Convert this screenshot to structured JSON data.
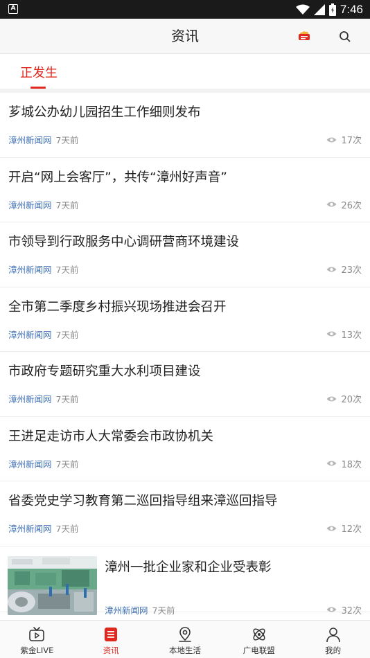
{
  "status_bar": {
    "time": "7:46",
    "left_icon_letter": "A"
  },
  "header": {
    "title": "资讯",
    "weather_icon": "weather-badge-icon",
    "search_icon": "search-icon"
  },
  "tabs": [
    {
      "label": "正发生",
      "active": true
    }
  ],
  "news": [
    {
      "title": "芗城公办幼儿园招生工作细则发布",
      "source": "漳州新闻网",
      "time": "7天前",
      "views": "17次"
    },
    {
      "title": "开启“网上会客厅”，共传“漳州好声音”",
      "source": "漳州新闻网",
      "time": "7天前",
      "views": "26次"
    },
    {
      "title": "市领导到行政服务中心调研营商环境建设",
      "source": "漳州新闻网",
      "time": "7天前",
      "views": "23次"
    },
    {
      "title": "全市第二季度乡村振兴现场推进会召开",
      "source": "漳州新闻网",
      "time": "7天前",
      "views": "13次"
    },
    {
      "title": "市政府专题研究重大水利项目建设",
      "source": "漳州新闻网",
      "time": "7天前",
      "views": "20次"
    },
    {
      "title": "王进足走访市人大常委会市政协机关",
      "source": "漳州新闻网",
      "time": "7天前",
      "views": "18次"
    },
    {
      "title": "省委党史学习教育第二巡回指导组来漳巡回指导",
      "source": "漳州新闻网",
      "time": "7天前",
      "views": "12次"
    }
  ],
  "image_news": {
    "title": "漳州一批企业家和企业受表彰",
    "source": "漳州新闻网",
    "time": "7天前",
    "views": "32次"
  },
  "bottom_nav": [
    {
      "label": "紫金LIVE",
      "icon": "tv-icon"
    },
    {
      "label": "资讯",
      "icon": "news-list-icon",
      "active": true
    },
    {
      "label": "本地生活",
      "icon": "location-pin-icon"
    },
    {
      "label": "广电联盟",
      "icon": "atom-icon"
    },
    {
      "label": "我的",
      "icon": "user-icon"
    }
  ],
  "colors": {
    "accent": "#e0281e",
    "source_blue": "#3b6db3",
    "meta_gray": "#8a8a8a"
  }
}
